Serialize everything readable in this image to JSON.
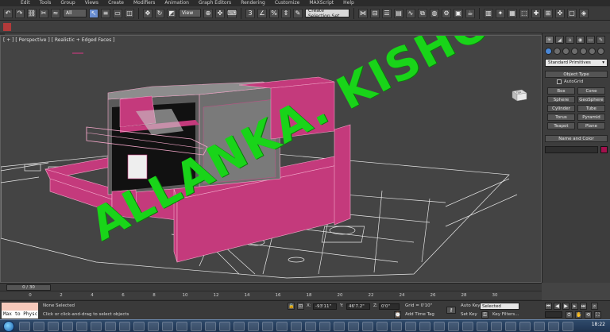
{
  "menu": [
    "Edit",
    "Tools",
    "Group",
    "Views",
    "Create",
    "Modifiers",
    "Animation",
    "Graph Editors",
    "Rendering",
    "Customize",
    "MAXScript",
    "Help"
  ],
  "toolbar": {
    "filter_value": "All",
    "refcoord_value": "View",
    "selection_set_placeholder": "Create Selection Set"
  },
  "viewport": {
    "label": "[ + ] [ Perspective ] [ Realistic + Edged Faces ]",
    "viewcube_label": "TOP",
    "watermark": "ALLANKA. KISHORE"
  },
  "command_panel": {
    "category_value": "Standard Primitives",
    "object_type_header": "Object Type",
    "autogrid_label": "AutoGrid",
    "primitives": [
      "Box",
      "Cone",
      "Sphere",
      "GeoSphere",
      "Cylinder",
      "Tube",
      "Torus",
      "Pyramid",
      "Teapot",
      "Plane"
    ],
    "name_color_header": "Name and Color",
    "object_color": "#a2114d"
  },
  "timeline": {
    "frame_indicator": "0 / 30",
    "ticks": [
      "0",
      "2",
      "4",
      "6",
      "8",
      "10",
      "12",
      "14",
      "16",
      "18",
      "20",
      "22",
      "24",
      "26",
      "28",
      "30"
    ]
  },
  "status": {
    "maxscript_text": "Max to Physc",
    "selection_status": "None Selected",
    "prompt": "Click or click-and-drag to select objects",
    "x_label": "X:",
    "x_value": "-93'11\"",
    "y_label": "Y:",
    "y_value": "46'7.2\"",
    "z_label": "Z:",
    "z_value": "0'0\"",
    "grid": "Grid = 0'10\"",
    "add_time_tag": "Add Time Tag",
    "auto_key": "Auto Key",
    "auto_key_value": "Selected",
    "set_key": "Set Key",
    "key_filters": "Key Filters..."
  },
  "taskbar": {
    "clock": "18:22"
  }
}
